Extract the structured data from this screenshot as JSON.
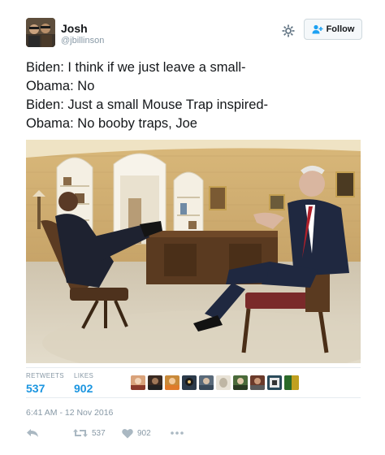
{
  "user": {
    "name": "Josh",
    "handle": "@jbillinson",
    "follow_label": "Follow"
  },
  "tweet": {
    "lines": [
      "Biden: I think if we just leave a small-",
      "Obama: No",
      "Biden: Just a small Mouse Trap inspired-",
      "Obama: No booby traps, Joe"
    ]
  },
  "stats": {
    "retweets_label": "RETWEETS",
    "retweets": "537",
    "likes_label": "LIKES",
    "likes": "902"
  },
  "timestamp": "6:41 AM - 12 Nov 2016",
  "actions": {
    "retweet_count": "537",
    "like_count": "902"
  },
  "colors": {
    "link_blue": "#1b95e0",
    "muted_gray": "#8899a6",
    "text": "#14171a"
  },
  "icons": [
    "gear-icon",
    "follow-person-icon",
    "reply-icon",
    "retweet-icon",
    "heart-icon",
    "more-icon"
  ]
}
